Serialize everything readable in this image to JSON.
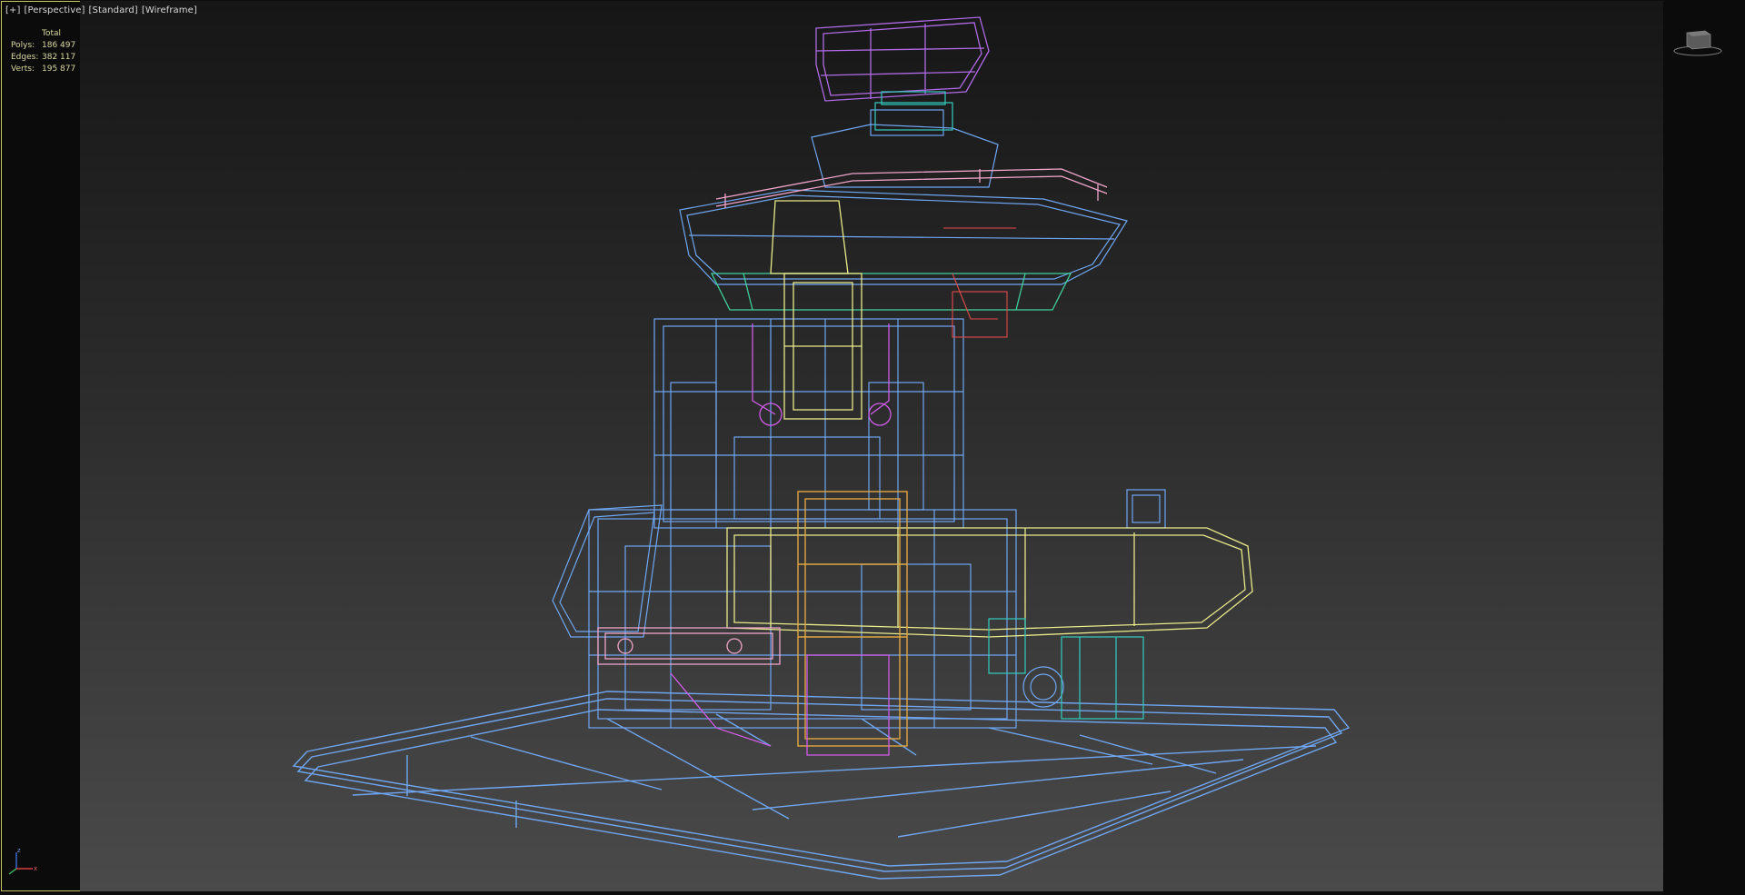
{
  "viewport": {
    "labels": [
      "[+]",
      "[Perspective]",
      "[Standard]",
      "[Wireframe]"
    ],
    "stats": {
      "header": "Total",
      "rows": [
        {
          "key": "Polys:",
          "value": "186 497"
        },
        {
          "key": "Edges:",
          "value": "382 117"
        },
        {
          "key": "Verts:",
          "value": "195 877"
        }
      ]
    }
  },
  "icons": {
    "navcube": "view-cube-icon",
    "axis": "axis-tripod-icon"
  },
  "colors": {
    "frame": "#c9c35f",
    "wire_blue": "#6fa6f2",
    "wire_yellow": "#e9ea8a",
    "wire_orange": "#e0a640",
    "wire_pink": "#f0a5c9",
    "wire_magenta": "#d05be9",
    "wire_teal": "#33c2b7",
    "wire_green": "#3fd19b",
    "wire_red": "#e24a4a",
    "wire_purple": "#b06ae7"
  }
}
